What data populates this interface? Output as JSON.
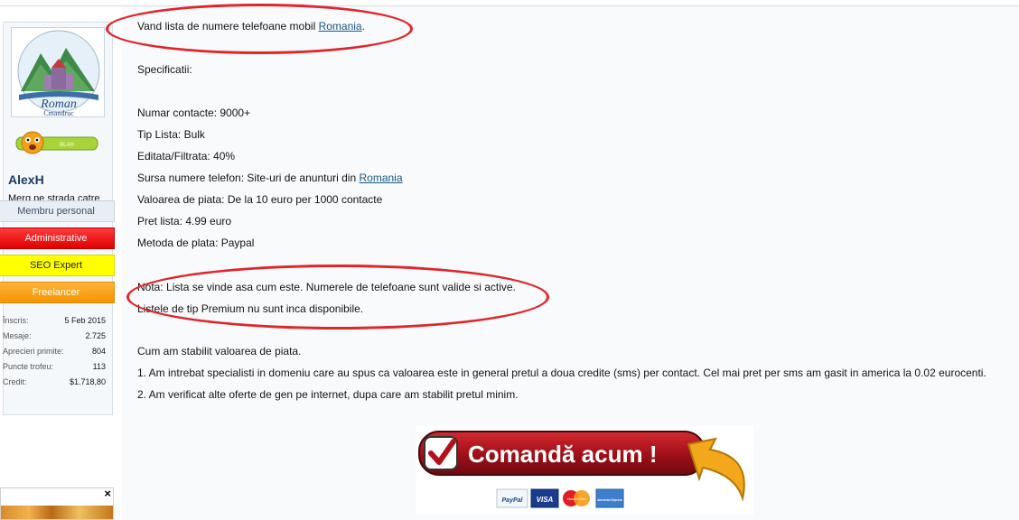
{
  "sidebar": {
    "badge_label": "BLAH",
    "avatar_caption_top": "Roman",
    "avatar_caption_bottom": "Cmandruc",
    "username": "AlexH",
    "user_title": "Merg pe strada catre Mine...",
    "ranks": [
      "Membru personal",
      "Administrative",
      "SEO Expert",
      "Freelancer"
    ],
    "stats": [
      {
        "label": "Înscris:",
        "value": "5 Feb 2015"
      },
      {
        "label": "Mesaje:",
        "value": "2.725"
      },
      {
        "label": "Aprecieri primite:",
        "value": "804"
      },
      {
        "label": "Puncte trofeu:",
        "value": "113"
      },
      {
        "label": "Credit:",
        "value": "$1.718,80"
      }
    ],
    "ad_close": "×"
  },
  "post": {
    "intro_text": "Vand lista de numere telefoane mobil ",
    "intro_link": "Romania",
    "intro_end": ".",
    "specs_heading": "Specificatii:",
    "specs": [
      "Numar contacte: 9000+",
      "Tip Lista: Bulk",
      "Editata/Filtrata: 40%"
    ],
    "source_text": "Sursa numere telefon: Site-uri de anunturi din ",
    "source_link": "Romania",
    "specs_after": [
      "Valoarea de piata: De la 10 euro per 1000 contacte",
      "Pret lista: 4.99 euro",
      "Metoda de plata: Paypal"
    ],
    "note_1": "Nota: Lista se vinde asa cum este. Numerele de telefoane sunt valide si active.",
    "note_2": "Listele de tip Premium nu sunt inca disponibile.",
    "value_heading": "Cum am stabilit valoarea de piata.",
    "value_1": "1. Am intrebat specialisti in domeniu care au spus ca valoarea este in general pretul a doua credite (sms) per contact. Cel mai pret per sms am gasit in america la 0.02 eurocenti.",
    "value_2": "2. Am verificat alte oferte de gen pe internet, dupa care am stabilit pretul minim."
  },
  "order_banner": {
    "label": "Comandă acum !",
    "payment_methods": [
      "PayPal",
      "VISA",
      "MasterCard",
      "American Express"
    ],
    "colors": {
      "banner": "#b0141c",
      "arrow": "#f2a81a",
      "highlight_ellipse": "#e0252b"
    }
  }
}
